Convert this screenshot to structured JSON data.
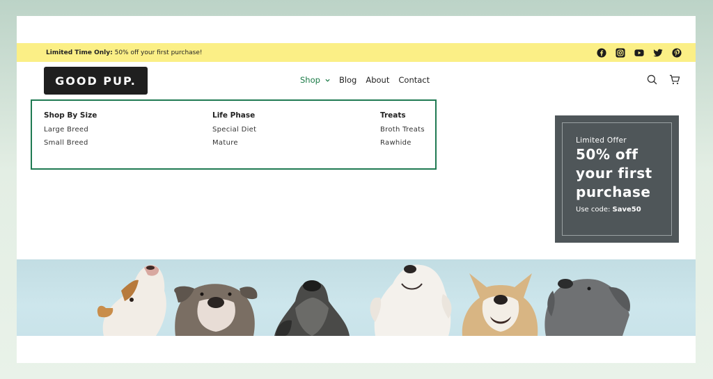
{
  "announcement": {
    "label": "Limited Time Only:",
    "text": "50% off your first purchase!"
  },
  "social": [
    "facebook-icon",
    "instagram-icon",
    "youtube-icon",
    "twitter-icon",
    "pinterest-icon"
  ],
  "logo": "GOOD PUP.",
  "nav": {
    "shop": "Shop",
    "blog": "Blog",
    "about": "About",
    "contact": "Contact"
  },
  "header_icons": [
    "search-icon",
    "cart-icon"
  ],
  "mega_menu": {
    "col1": {
      "title": "Shop By Size",
      "items": [
        "Large Breed",
        "Small Breed"
      ]
    },
    "col2": {
      "title": "Life Phase",
      "items": [
        "Special Diet",
        "Mature"
      ]
    },
    "col3": {
      "title": "Treats",
      "items": [
        "Broth Treats",
        "Rawhide"
      ]
    }
  },
  "offer": {
    "label": "Limited Offer",
    "headline_1": "50% off",
    "headline_2": "your first",
    "headline_3": "purchase",
    "code_label": "Use code:",
    "code": "Save50"
  },
  "colors": {
    "announce_bg": "#fbef86",
    "accent_green": "#1a7a46",
    "offer_bg": "#4f5659",
    "hero_bg": "#c9e3ea"
  }
}
